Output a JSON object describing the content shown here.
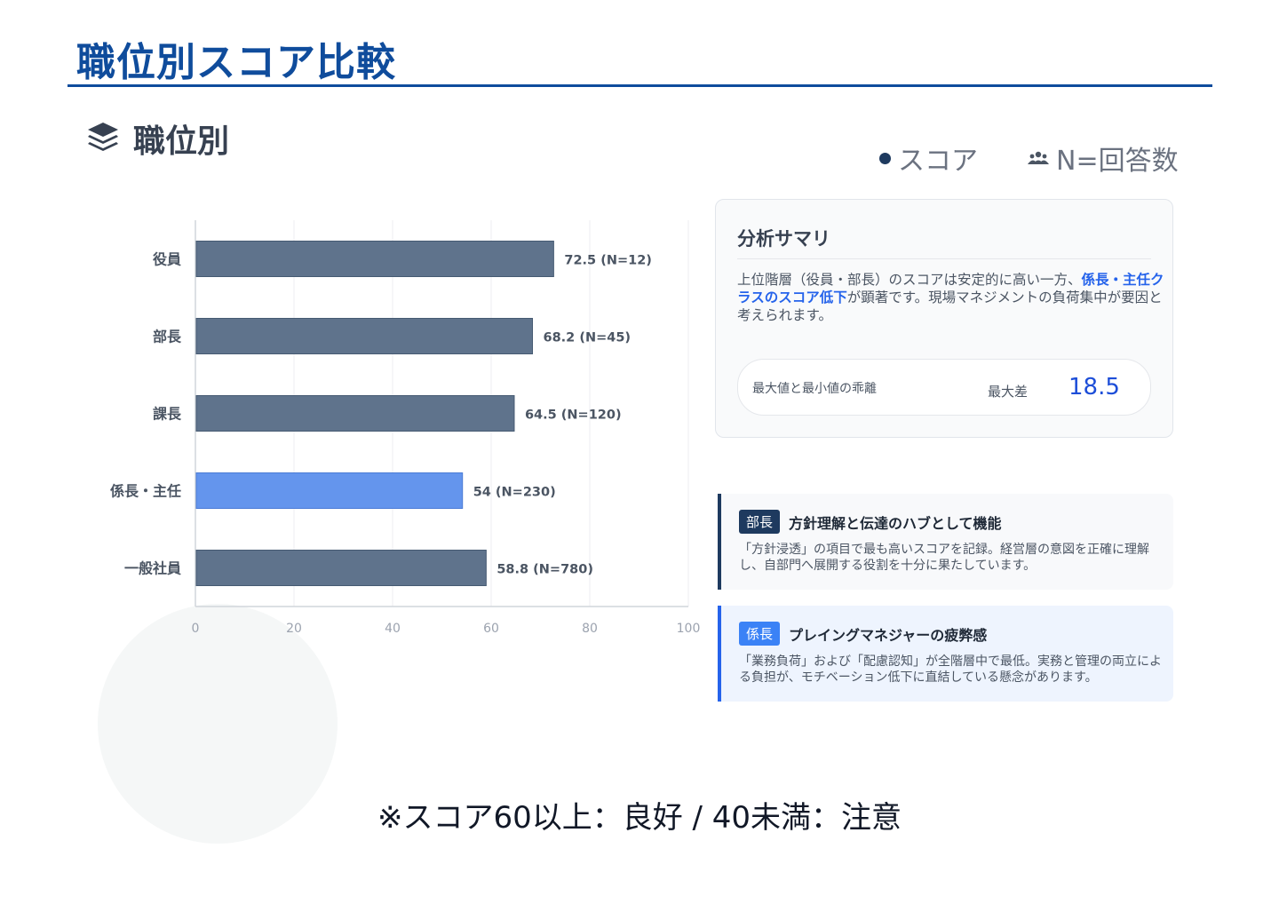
{
  "page": {
    "title": "職位別スコア比較",
    "section_label": "職位別",
    "legend": {
      "score_label": "スコア",
      "n_label": "N=回答数"
    },
    "note": "※スコア60以上：良好 / 40未満：注意"
  },
  "colors": {
    "primary": "#0f4c9c",
    "bar_default": "#5f738c",
    "bar_highlight": "#6495ed",
    "accent_blue": "#2563eb"
  },
  "icons": {
    "section": "layers-icon",
    "legend_n": "users-icon"
  },
  "chart_data": {
    "type": "bar",
    "orientation": "horizontal",
    "categories": [
      "役員",
      "部長",
      "課長",
      "係長・主任",
      "一般社員"
    ],
    "series": [
      {
        "values": [
          72.5,
          68.2,
          64.5,
          54,
          58.8
        ]
      }
    ],
    "n": [
      12,
      45,
      120,
      230,
      780
    ],
    "data_labels": [
      "72.5 (N=12)",
      "68.2 (N=45)",
      "64.5 (N=120)",
      "54 (N=230)",
      "58.8 (N=780)"
    ],
    "highlight_index": 3,
    "xlim": [
      0,
      100
    ],
    "xticks": [
      0,
      20,
      40,
      60,
      80,
      100
    ],
    "grid": true,
    "xlabel": "",
    "ylabel": ""
  },
  "summary": {
    "title": "分析サマリ",
    "text_before": "上位階層（役員・部長）のスコアは安定的に高い一方、",
    "text_highlight": "係長・主任クラスのスコア低下",
    "text_after": "が顕著です。現場マネジメントの負荷集中が要因と考えられます。",
    "metric_label": "最大値と最小値の乖離",
    "metric_diff_label": "最大差",
    "metric_value": "18.5"
  },
  "insights": [
    {
      "badge": "部長",
      "title": "方針理解と伝達のハブとして機能",
      "text": "「方針浸透」の項目で最も高いスコアを記録。経営層の意図を正確に理解し、自部門へ展開する役割を十分に果たしています。"
    },
    {
      "badge": "係長",
      "title": "プレイングマネジャーの疲弊感",
      "text": "「業務負荷」および「配慮認知」が全階層中で最低。実務と管理の両立による負担が、モチベーション低下に直結している懸念があります。"
    }
  ]
}
